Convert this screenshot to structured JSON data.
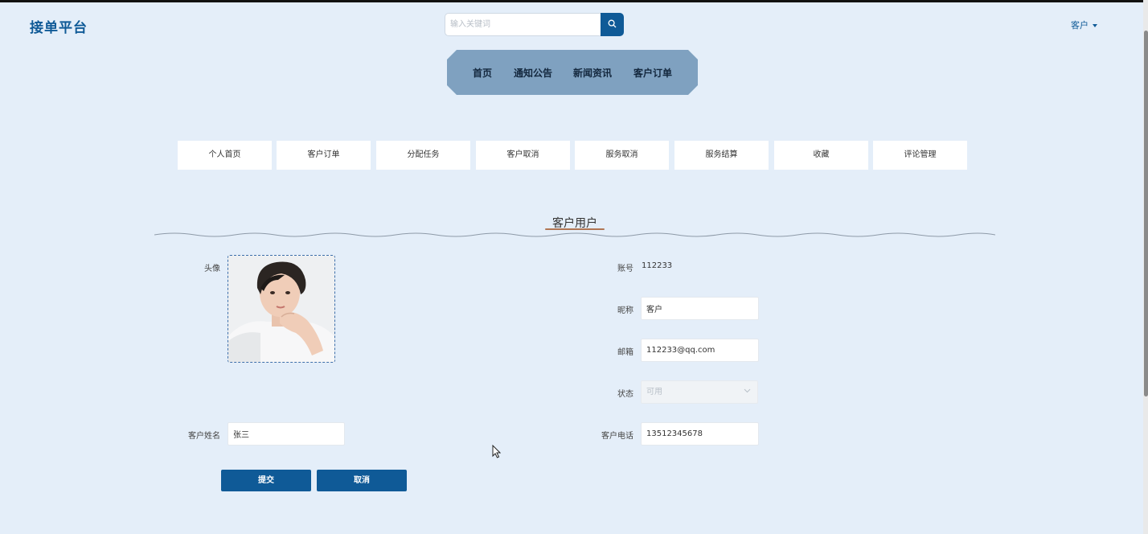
{
  "header": {
    "logo": "接单平台",
    "search_placeholder": "输入关键词",
    "user_menu": "客户"
  },
  "main_nav": [
    "首页",
    "通知公告",
    "新闻资讯",
    "客户订单"
  ],
  "sub_nav": [
    "个人首页",
    "客户订单",
    "分配任务",
    "客户取消",
    "服务取消",
    "服务结算",
    "收藏",
    "评论管理"
  ],
  "section_title": "客户用户",
  "form": {
    "avatar_label": "头像",
    "account_label": "账号",
    "account_value": "112233",
    "nickname_label": "昵称",
    "nickname_value": "客户",
    "email_label": "邮箱",
    "email_value": "112233@qq.com",
    "status_label": "状态",
    "status_value": "可用",
    "name_label": "客户姓名",
    "name_value": "张三",
    "phone_label": "客户电话",
    "phone_value": "13512345678",
    "submit_label": "提交",
    "cancel_label": "取消"
  },
  "colors": {
    "brand": "#0f5a97",
    "page_bg": "#e4eef9",
    "nav_bg": "#7fa1c0"
  }
}
